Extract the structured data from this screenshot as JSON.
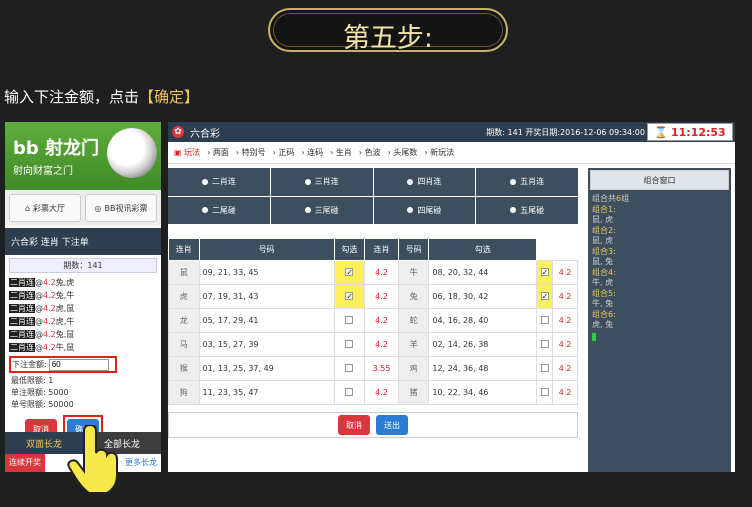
{
  "step_title": "第五步:",
  "instruction": {
    "prefix": "输入下注金额，点击",
    "highlight": "【确定】"
  },
  "left": {
    "brand": "射龙门",
    "slogan": "射向财富之门",
    "nav": [
      "彩票大厅",
      "BB视讯彩票"
    ],
    "order_title": "六合彩 连肖 下注单",
    "period": "期数：141",
    "orders": [
      {
        "tag": "二肖连",
        "at": "@",
        "odd": "4.2",
        "pair": "兔,虎"
      },
      {
        "tag": "二肖连",
        "at": "@",
        "odd": "4.2",
        "pair": "兔,牛"
      },
      {
        "tag": "二肖连",
        "at": "@",
        "odd": "4.2",
        "pair": "虎,鼠"
      },
      {
        "tag": "二肖连",
        "at": "@",
        "odd": "4.2",
        "pair": "虎,牛"
      },
      {
        "tag": "二肖连",
        "at": "@",
        "odd": "4.2",
        "pair": "兔,鼠"
      },
      {
        "tag": "二肖连",
        "at": "@",
        "odd": "4.2",
        "pair": "牛,鼠"
      }
    ],
    "bet_label": "下注金额:",
    "bet_value": "60",
    "limits": [
      "最低限额: 1",
      "单注限额: 5000",
      "单号限额: 50000"
    ],
    "cancel": "取消",
    "confirm": "确定",
    "tab1": "双面长龙",
    "tab2": "全部长龙",
    "sub1": "连续开奖",
    "sub2": "更多长龙"
  },
  "main": {
    "title": "六合彩",
    "period_info": "期数: 141   开奖日期:2016-12-06 09:34:00",
    "timer": "11:12:53",
    "crumbs": [
      "玩法",
      "两面",
      "特别号",
      "正码",
      "连码",
      "生肖",
      "色波",
      "头尾数",
      "新玩法"
    ],
    "types": [
      "二肖连",
      "三肖连",
      "四肖连",
      "五肖连",
      "二尾碰",
      "三尾碰",
      "四尾碰",
      "五尾碰"
    ],
    "headers": [
      "连肖",
      "号码",
      "勾选",
      "连肖",
      "号码",
      "勾选"
    ],
    "rows": [
      {
        "z1": "鼠",
        "n1": "09, 21, 33, 45",
        "c1": true,
        "o1": "4.2",
        "z2": "牛",
        "n2": "08, 20, 32, 44",
        "c2": true,
        "o2": "4.2"
      },
      {
        "z1": "虎",
        "n1": "07, 19, 31, 43",
        "c1": true,
        "o1": "4.2",
        "z2": "兔",
        "n2": "06, 18, 30, 42",
        "c2": true,
        "o2": "4.2"
      },
      {
        "z1": "龙",
        "n1": "05, 17, 29, 41",
        "c1": false,
        "o1": "4.2",
        "z2": "蛇",
        "n2": "04, 16, 28, 40",
        "c2": false,
        "o2": "4.2"
      },
      {
        "z1": "马",
        "n1": "03, 15, 27, 39",
        "c1": false,
        "o1": "4.2",
        "z2": "羊",
        "n2": "02, 14, 26, 38",
        "c2": false,
        "o2": "4.2"
      },
      {
        "z1": "猴",
        "n1": "01, 13, 25, 37, 49",
        "c1": false,
        "o1": "3.55",
        "z2": "鸡",
        "n2": "12, 24, 36, 48",
        "c2": false,
        "o2": "4.2"
      },
      {
        "z1": "狗",
        "n1": "11, 23, 35, 47",
        "c1": false,
        "o1": "4.2",
        "z2": "猪",
        "n2": "10, 22, 34, 46",
        "c2": false,
        "o2": "4.2"
      }
    ],
    "cancel": "取消",
    "submit": "送出",
    "combo_header": "组合窗口",
    "combo_total_prefix": "组合共",
    "combo_total": "6",
    "combo_total_suffix": "组",
    "combos": [
      {
        "label": "组合1:",
        "pair": "鼠, 虎"
      },
      {
        "label": "组合2:",
        "pair": "鼠, 虎"
      },
      {
        "label": "组合3:",
        "pair": "鼠, 兔"
      },
      {
        "label": "组合4:",
        "pair": "牛, 虎"
      },
      {
        "label": "组合5:",
        "pair": "牛, 兔"
      },
      {
        "label": "组合6:",
        "pair": "虎, 兔"
      }
    ]
  }
}
